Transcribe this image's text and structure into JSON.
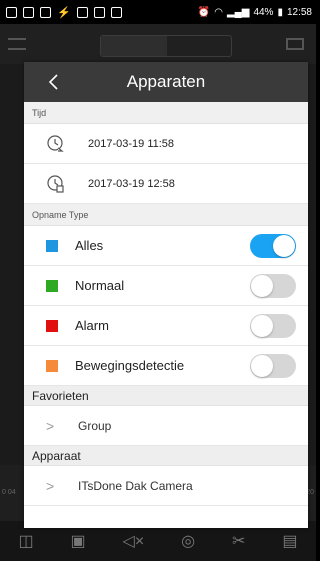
{
  "status_bar": {
    "alarm_icon": "alarm-clock-icon",
    "battery": "44%",
    "time": "12:58"
  },
  "timeline": {
    "left_edge_label": "0 04",
    "right_edge_label": "20"
  },
  "bottom_toolbar": {
    "icons": [
      "camera-icon",
      "video-record-icon",
      "mute-icon",
      "zoom-icon",
      "cut-icon",
      "save-icon"
    ]
  },
  "panel": {
    "title": "Apparaten",
    "time_section": {
      "label": "Tijd",
      "start": "2017-03-19 11:58",
      "end": "2017-03-19 12:58"
    },
    "recording_type_section": {
      "label": "Opname Type",
      "types": [
        {
          "label": "Alles",
          "color": "#1e96e0",
          "enabled": true
        },
        {
          "label": "Normaal",
          "color": "#2fa823",
          "enabled": false
        },
        {
          "label": "Alarm",
          "color": "#e01010",
          "enabled": false
        },
        {
          "label": "Bewegingsdetectie",
          "color": "#f58a3a",
          "enabled": false
        }
      ]
    },
    "favorites_section": {
      "label": "Favorieten",
      "items": [
        {
          "label": "Group"
        }
      ]
    },
    "device_section": {
      "label": "Apparaat",
      "items": [
        {
          "label": "ITsDone Dak Camera"
        }
      ]
    }
  }
}
